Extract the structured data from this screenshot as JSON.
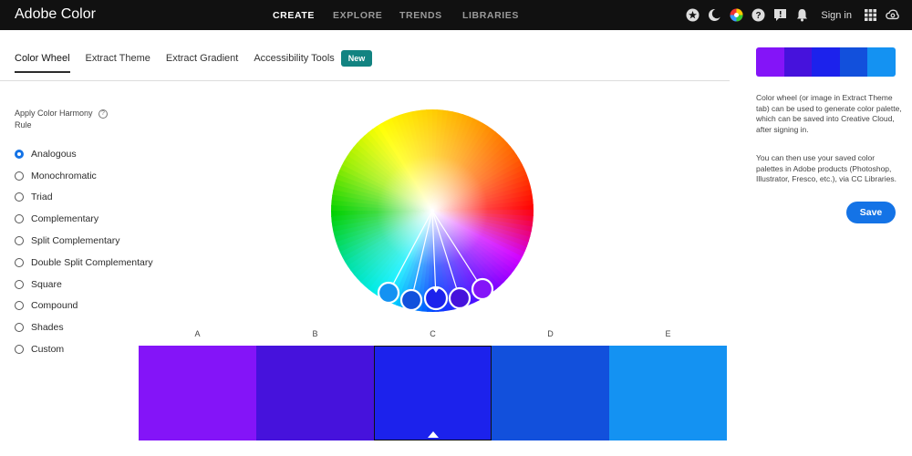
{
  "app": {
    "title": "Adobe Color"
  },
  "nav": {
    "items": [
      {
        "label": "CREATE",
        "active": true
      },
      {
        "label": "EXPLORE",
        "active": false
      },
      {
        "label": "TRENDS",
        "active": false
      },
      {
        "label": "LIBRARIES",
        "active": false
      }
    ],
    "icons": [
      "star-icon",
      "moon-icon",
      "color-wheel-icon",
      "help-icon",
      "feedback-icon",
      "notification-icon",
      "apps-grid-icon",
      "creative-cloud-icon"
    ],
    "signin_label": "Sign in"
  },
  "tabs": {
    "items": [
      {
        "label": "Color Wheel",
        "active": true
      },
      {
        "label": "Extract Theme",
        "active": false
      },
      {
        "label": "Extract Gradient",
        "active": false
      },
      {
        "label": "Accessibility Tools",
        "active": false
      }
    ],
    "badge": "New"
  },
  "harmony": {
    "title": "Apply Color Harmony Rule",
    "rules": [
      {
        "label": "Analogous",
        "checked": true
      },
      {
        "label": "Monochromatic",
        "checked": false
      },
      {
        "label": "Triad",
        "checked": false
      },
      {
        "label": "Complementary",
        "checked": false
      },
      {
        "label": "Split Complementary",
        "checked": false
      },
      {
        "label": "Double Split Complementary",
        "checked": false
      },
      {
        "label": "Square",
        "checked": false
      },
      {
        "label": "Compound",
        "checked": false
      },
      {
        "label": "Shades",
        "checked": false
      },
      {
        "label": "Custom",
        "checked": false
      }
    ]
  },
  "palette": {
    "swatches": [
      {
        "letter": "A",
        "color": "#8414F8"
      },
      {
        "letter": "B",
        "color": "#4612DC"
      },
      {
        "letter": "C",
        "color": "#1C22EC",
        "selected": true
      },
      {
        "letter": "D",
        "color": "#1250DC"
      },
      {
        "letter": "E",
        "color": "#1492F2"
      }
    ]
  },
  "sidebar": {
    "description_1": "Color wheel (or image in Extract Theme tab) can be used to generate color palette, which can be saved into Creative Cloud, after signing in.",
    "description_2": "You can then use your saved color palettes in Adobe products (Photoshop, Illustrator, Fresco, etc.), via CC Libraries.",
    "save_label": "Save"
  },
  "colors": {
    "accent": "#1473e6",
    "badge": "#128381",
    "topbar": "#111111"
  }
}
